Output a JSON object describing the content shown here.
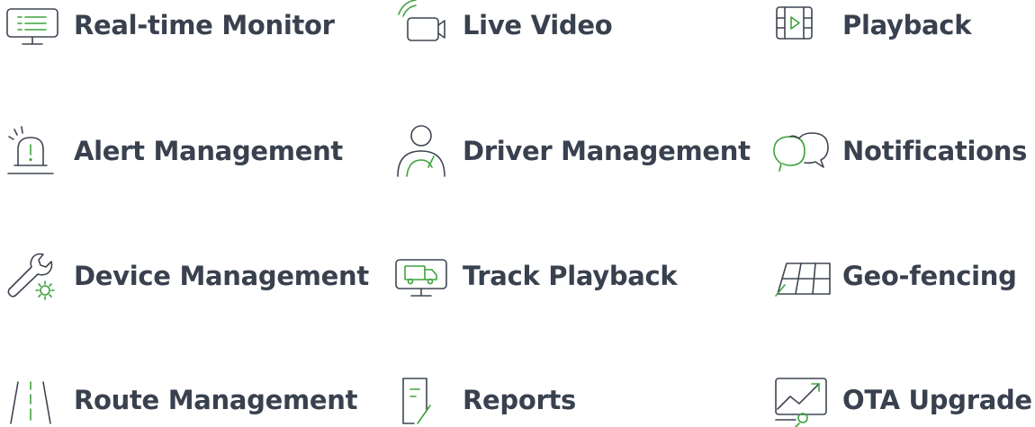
{
  "colors": {
    "text": "#39414f",
    "icon_stroke": "#3f4652",
    "accent": "#3da33d"
  },
  "features": [
    {
      "label": "Real-time Monitor",
      "icon": "monitor-list-icon"
    },
    {
      "label": "Live Video",
      "icon": "video-camera-icon"
    },
    {
      "label": "Playback",
      "icon": "film-play-icon"
    },
    {
      "label": "Alert Management",
      "icon": "alarm-siren-icon"
    },
    {
      "label": "Driver Management",
      "icon": "driver-icon"
    },
    {
      "label": "Notifications",
      "icon": "chat-bubbles-icon"
    },
    {
      "label": "Device Management",
      "icon": "wrench-gear-icon"
    },
    {
      "label": "Track Playback",
      "icon": "monitor-truck-icon"
    },
    {
      "label": "Geo-fencing",
      "icon": "grid-fence-icon"
    },
    {
      "label": "Route Management",
      "icon": "road-lanes-icon"
    },
    {
      "label": "Reports",
      "icon": "report-document-icon"
    },
    {
      "label": "OTA Upgrade",
      "icon": "chart-upgrade-icon"
    }
  ]
}
